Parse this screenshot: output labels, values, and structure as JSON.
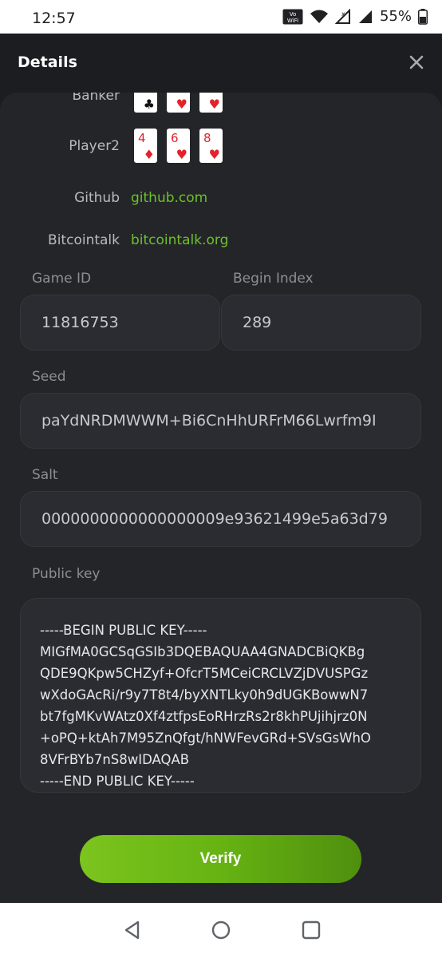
{
  "status_bar": {
    "time": "12:57",
    "volte_label": "VoWiFi",
    "battery": "55%"
  },
  "header": {
    "title": "Details"
  },
  "hands": {
    "banker": {
      "label": "Banker",
      "cards": [
        {
          "rank": "",
          "suit": "♣"
        },
        {
          "rank": "",
          "suit": "♥"
        },
        {
          "rank": "",
          "suit": "♥"
        }
      ]
    },
    "player2": {
      "label": "Player2",
      "cards": [
        {
          "rank": "4",
          "suit": "♦"
        },
        {
          "rank": "6",
          "suit": "♥"
        },
        {
          "rank": "8",
          "suit": "♥"
        }
      ]
    }
  },
  "links": {
    "github": {
      "label": "Github",
      "text": "github.com"
    },
    "bitcointalk": {
      "label": "Bitcointalk",
      "text": "bitcointalk.org"
    }
  },
  "fields": {
    "game_id": {
      "label": "Game ID",
      "value": "11816753"
    },
    "begin_index": {
      "label": "Begin Index",
      "value": "289"
    },
    "seed": {
      "label": "Seed",
      "value": "paYdNRDMWWM+Bi6CnHhURFrM66Lwrfm9I"
    },
    "salt": {
      "label": "Salt",
      "value": "0000000000000000009e93621499e5a63d79"
    },
    "public_key": {
      "label": "Public key",
      "lines": [
        "-----BEGIN PUBLIC KEY-----",
        "MIGfMA0GCSqGSIb3DQEBAQUAA4GNADCBiQKBg",
        "QDE9QKpw5CHZyf+OfcrT5MCeiCRCLVZjDVUSPGz",
        "wXdoGAcRi/r9y7T8t4/byXNTLky0h9dUGKBowwN7",
        "bt7fgMKvWAtz0Xf4ztfpsEoRHrzRs2r8khPUjihjrz0N",
        "+oPQ+ktAh7M95ZnQfgt/hNWFevGRd+SVsGsWhO",
        "8VFrBYb7nS8wIDAQAB",
        "-----END PUBLIC KEY-----"
      ]
    }
  },
  "actions": {
    "verify_label": "Verify"
  },
  "colors": {
    "accent": "#6cc12a",
    "background": "#1c1d21",
    "panel": "#242529",
    "card_red": "#e3222b"
  }
}
